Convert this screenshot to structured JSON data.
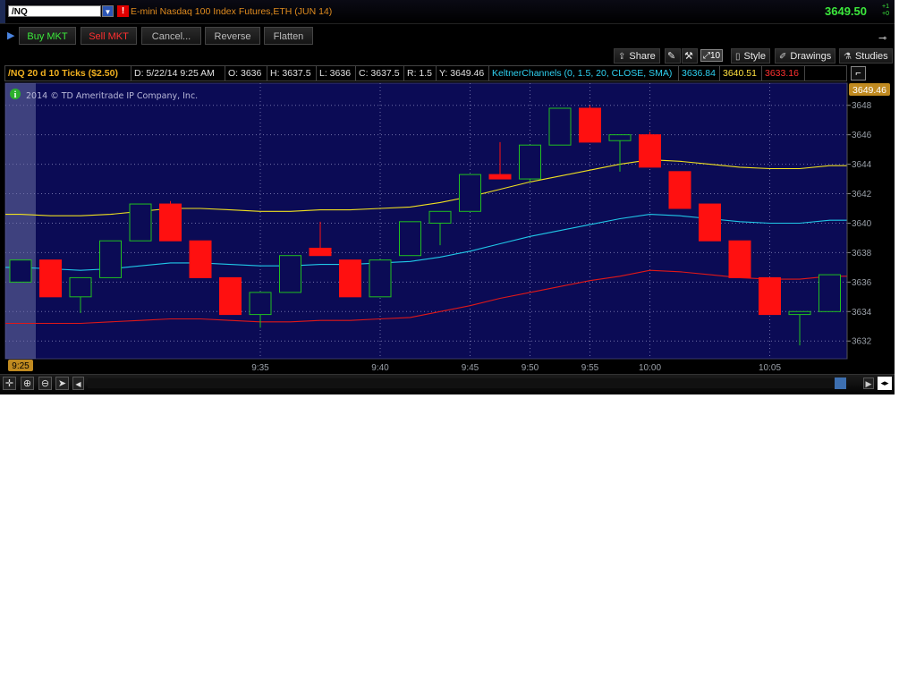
{
  "window": {
    "symbol": "/NQ",
    "description": "E-mini Nasdaq 100 Index Futures,ETH (JUN 14)",
    "alert_icon": "!",
    "last_price": "3649.50",
    "change_top": "+1",
    "change_bottom": "+0"
  },
  "trade_buttons": {
    "buy": "Buy MKT",
    "sell": "Sell MKT",
    "cancel": "Cancel...",
    "reverse": "Reverse",
    "flatten": "Flatten"
  },
  "chart_tools": {
    "share": "Share",
    "zoom_badge": "10",
    "style": "Style",
    "drawings": "Drawings",
    "studies": "Studies"
  },
  "info_bar": {
    "title": "/NQ 20 d 10 Ticks ($2.50)",
    "date": "D: 5/22/14 9:25 AM",
    "open": "O: 3636",
    "high": "H: 3637.5",
    "low": "L: 3636",
    "close": "C: 3637.5",
    "range": "R: 1.5",
    "y": "Y: 3649.46",
    "study": "KeltnerChannels (0, 1.5, 20, CLOSE, SMA)",
    "mid_value": "3636.84",
    "upper_value": "3640.51",
    "lower_value": "3633.16"
  },
  "copyright": "2014 © TD Ameritrade IP Company, Inc.",
  "colors": {
    "background": "#0b0b55",
    "up_candle": "#20c020",
    "down_candle": "#ff1010",
    "upper_band": "#f0e020",
    "middle_band": "#20c8e8",
    "lower_band": "#e01818",
    "price_label_bg": "#c08a20"
  },
  "chart_data": {
    "type": "candlestick",
    "price_axis": {
      "ticks": [
        3632,
        3634,
        3636,
        3638,
        3640,
        3642,
        3644,
        3646,
        3648
      ],
      "ylim": [
        3630.8,
        3649.5
      ],
      "current_label": "3649.46"
    },
    "time_axis": {
      "labels": [
        "9:25",
        "9:35",
        "9:40",
        "9:45",
        "9:50",
        "9:55",
        "10:00",
        "10:05"
      ],
      "label_bar_index": [
        0,
        8,
        12,
        15,
        17,
        19,
        21,
        25
      ]
    },
    "candles": [
      {
        "o": 3636,
        "h": 3637.5,
        "l": 3636,
        "c": 3637.5
      },
      {
        "o": 3637.5,
        "h": 3637.5,
        "l": 3635,
        "c": 3635
      },
      {
        "o": 3635,
        "h": 3636.3,
        "l": 3633.9,
        "c": 3636.3
      },
      {
        "o": 3636.3,
        "h": 3638.8,
        "l": 3636.3,
        "c": 3638.8
      },
      {
        "o": 3638.8,
        "h": 3641.3,
        "l": 3638.8,
        "c": 3641.3
      },
      {
        "o": 3641.3,
        "h": 3641.5,
        "l": 3638.8,
        "c": 3638.8
      },
      {
        "o": 3638.8,
        "h": 3638.8,
        "l": 3636.3,
        "c": 3636.3
      },
      {
        "o": 3636.3,
        "h": 3636.3,
        "l": 3633.8,
        "c": 3633.8
      },
      {
        "o": 3633.8,
        "h": 3635.3,
        "l": 3632.9,
        "c": 3635.3
      },
      {
        "o": 3635.3,
        "h": 3637.8,
        "l": 3635.3,
        "c": 3637.8
      },
      {
        "o": 3638.3,
        "h": 3640.1,
        "l": 3637.8,
        "c": 3637.8
      },
      {
        "o": 3637.5,
        "h": 3637.5,
        "l": 3635,
        "c": 3635
      },
      {
        "o": 3635,
        "h": 3637.5,
        "l": 3635,
        "c": 3637.5
      },
      {
        "o": 3637.8,
        "h": 3640.1,
        "l": 3637.8,
        "c": 3640.1
      },
      {
        "o": 3640,
        "h": 3640.8,
        "l": 3638.5,
        "c": 3640.8
      },
      {
        "o": 3640.8,
        "h": 3643.3,
        "l": 3640.8,
        "c": 3643.3
      },
      {
        "o": 3643.3,
        "h": 3645.5,
        "l": 3643,
        "c": 3643
      },
      {
        "o": 3643,
        "h": 3645.3,
        "l": 3642.8,
        "c": 3645.3
      },
      {
        "o": 3645.3,
        "h": 3647.8,
        "l": 3645.3,
        "c": 3647.8
      },
      {
        "o": 3647.8,
        "h": 3648,
        "l": 3645.5,
        "c": 3645.5
      },
      {
        "o": 3645.6,
        "h": 3646,
        "l": 3643.5,
        "c": 3646
      },
      {
        "o": 3646,
        "h": 3646.2,
        "l": 3643.8,
        "c": 3643.8
      },
      {
        "o": 3643.5,
        "h": 3643.5,
        "l": 3641,
        "c": 3641
      },
      {
        "o": 3641.3,
        "h": 3641.3,
        "l": 3638.8,
        "c": 3638.8
      },
      {
        "o": 3638.8,
        "h": 3638.8,
        "l": 3636.3,
        "c": 3636.3
      },
      {
        "o": 3636.3,
        "h": 3636.3,
        "l": 3633.8,
        "c": 3633.8
      },
      {
        "o": 3633.8,
        "h": 3634,
        "l": 3631.7,
        "c": 3634
      },
      {
        "o": 3634,
        "h": 3636.5,
        "l": 3634,
        "c": 3636.5
      }
    ],
    "bands": {
      "upper": [
        3640.6,
        3640.5,
        3640.5,
        3640.6,
        3640.8,
        3641,
        3641,
        3640.9,
        3640.8,
        3640.8,
        3640.9,
        3640.9,
        3641,
        3641.1,
        3641.4,
        3641.8,
        3642.3,
        3642.8,
        3643.2,
        3643.6,
        3644,
        3644.3,
        3644.2,
        3644,
        3643.8,
        3643.7,
        3643.7,
        3643.9
      ],
      "middle": [
        3637,
        3636.9,
        3636.8,
        3636.9,
        3637.1,
        3637.3,
        3637.3,
        3637.2,
        3637.1,
        3637.1,
        3637.2,
        3637.2,
        3637.3,
        3637.4,
        3637.7,
        3638.1,
        3638.6,
        3639.1,
        3639.5,
        3639.9,
        3640.3,
        3640.6,
        3640.5,
        3640.3,
        3640.1,
        3640,
        3640,
        3640.2
      ],
      "lower": [
        3633.2,
        3633.2,
        3633.2,
        3633.3,
        3633.4,
        3633.5,
        3633.5,
        3633.4,
        3633.3,
        3633.3,
        3633.4,
        3633.4,
        3633.5,
        3633.6,
        3634,
        3634.4,
        3634.9,
        3635.3,
        3635.7,
        3636.1,
        3636.4,
        3636.8,
        3636.7,
        3636.5,
        3636.3,
        3636.2,
        3636.2,
        3636.4
      ]
    }
  }
}
